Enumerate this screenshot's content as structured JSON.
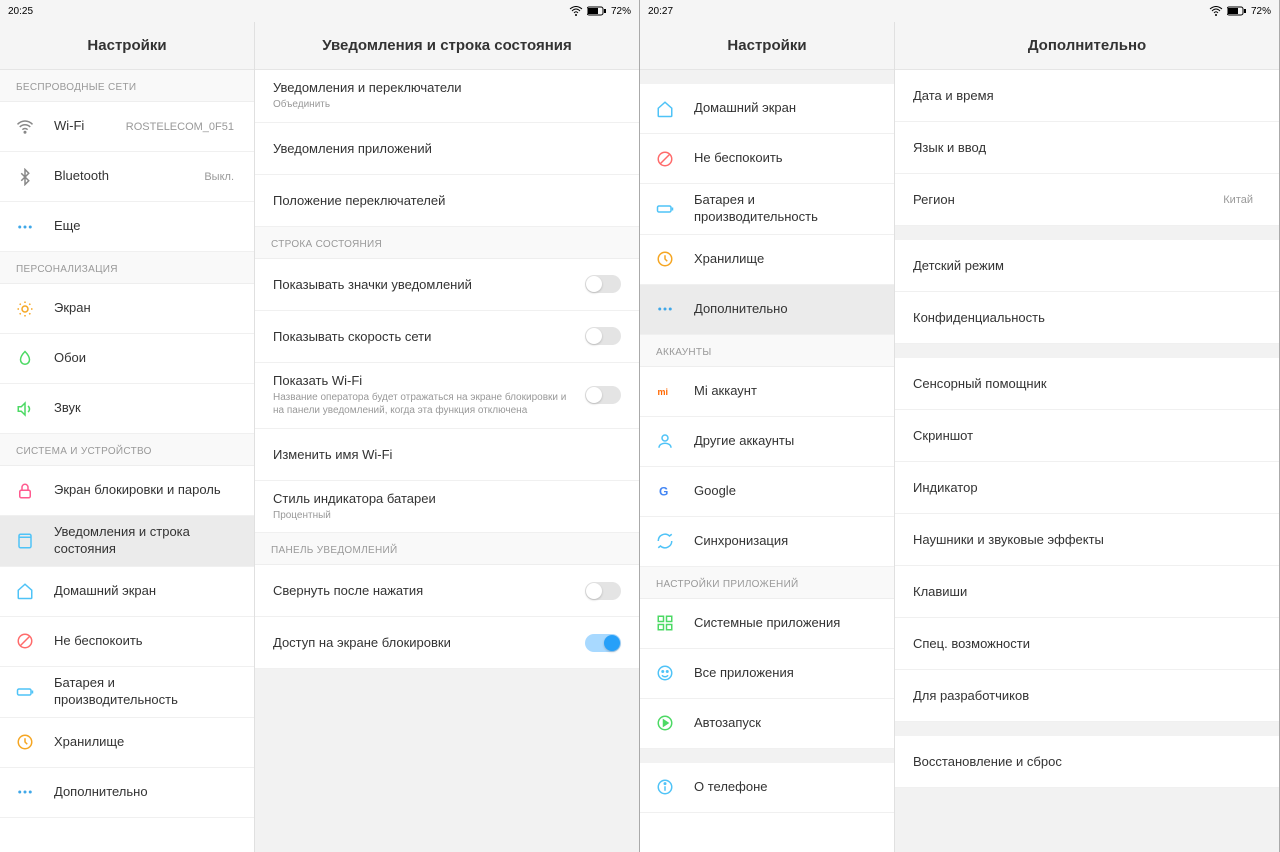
{
  "left_screen": {
    "status": {
      "time": "20:25",
      "battery": "72%"
    },
    "sidebar": {
      "title": "Настройки",
      "sections": [
        {
          "header": "БЕСПРОВОДНЫЕ СЕТИ",
          "items": [
            {
              "label": "Wi-Fi",
              "value": "ROSTELECOM_0F51"
            },
            {
              "label": "Bluetooth",
              "value": "Выкл."
            },
            {
              "label": "Еще"
            }
          ]
        },
        {
          "header": "ПЕРСОНАЛИЗАЦИЯ",
          "items": [
            {
              "label": "Экран"
            },
            {
              "label": "Обои"
            },
            {
              "label": "Звук"
            }
          ]
        },
        {
          "header": "СИСТЕМА И УСТРОЙСТВО",
          "items": [
            {
              "label": "Экран блокировки и пароль"
            },
            {
              "label": "Уведомления и строка состояния",
              "selected": true
            },
            {
              "label": "Домашний экран"
            },
            {
              "label": "Не беспокоить"
            },
            {
              "label": "Батарея и производительность"
            },
            {
              "label": "Хранилище"
            },
            {
              "label": "Дополнительно"
            }
          ]
        }
      ]
    },
    "detail": {
      "title": "Уведомления и строка состояния",
      "groups": [
        {
          "items": [
            {
              "label": "Уведомления и переключатели",
              "sub": "Объединить",
              "chevron": true
            },
            {
              "label": "Уведомления приложений",
              "chevron": true
            },
            {
              "label": "Положение переключателей",
              "chevron": true
            }
          ]
        },
        {
          "header": "СТРОКА СОСТОЯНИЯ",
          "items": [
            {
              "label": "Показывать значки уведомлений",
              "toggle": false
            },
            {
              "label": "Показывать скорость сети",
              "toggle": false
            },
            {
              "label": "Показать Wi-Fi",
              "sub": "Название оператора будет отражаться на экране блокировки и на панели уведомлений, когда эта функция отключена",
              "toggle": false
            },
            {
              "label": "Изменить имя Wi-Fi",
              "chevron": true
            },
            {
              "label": "Стиль индикатора батареи",
              "sub": "Процентный",
              "chevron": true
            }
          ]
        },
        {
          "header": "ПАНЕЛЬ УВЕДОМЛЕНИЙ",
          "items": [
            {
              "label": "Свернуть после нажатия",
              "toggle": false
            },
            {
              "label": "Доступ на экране блокировки",
              "toggle": true
            }
          ]
        }
      ]
    }
  },
  "right_screen": {
    "status": {
      "time": "20:27",
      "battery": "72%"
    },
    "sidebar": {
      "title": "Настройки",
      "sections": [
        {
          "items": [
            {
              "label": "Домашний экран"
            },
            {
              "label": "Не беспокоить"
            },
            {
              "label": "Батарея и производительность"
            },
            {
              "label": "Хранилище"
            },
            {
              "label": "Дополнительно",
              "selected": true
            }
          ]
        },
        {
          "header": "АККАУНТЫ",
          "items": [
            {
              "label": "Mi аккаунт"
            },
            {
              "label": "Другие аккаунты"
            },
            {
              "label": "Google"
            },
            {
              "label": "Синхронизация"
            }
          ]
        },
        {
          "header": "НАСТРОЙКИ ПРИЛОЖЕНИЙ",
          "items": [
            {
              "label": "Системные приложения"
            },
            {
              "label": "Все приложения"
            },
            {
              "label": "Автозапуск"
            }
          ]
        },
        {
          "items": [
            {
              "label": "О телефоне"
            }
          ]
        }
      ]
    },
    "detail": {
      "title": "Дополнительно",
      "groups": [
        {
          "items": [
            {
              "label": "Дата и время",
              "chevron": true
            },
            {
              "label": "Язык и ввод",
              "chevron": true
            },
            {
              "label": "Регион",
              "value": "Китай",
              "chevron": true
            }
          ]
        },
        {
          "items": [
            {
              "label": "Детский режим",
              "chevron": true
            },
            {
              "label": "Конфиденциальность",
              "chevron": true
            }
          ]
        },
        {
          "items": [
            {
              "label": "Сенсорный помощник",
              "chevron": true
            },
            {
              "label": "Скриншот",
              "chevron": true
            },
            {
              "label": "Индикатор",
              "chevron": true
            },
            {
              "label": "Наушники и звуковые эффекты",
              "chevron": true
            },
            {
              "label": "Клавиши",
              "chevron": true
            },
            {
              "label": "Спец. возможности",
              "chevron": true
            },
            {
              "label": "Для разработчиков",
              "chevron": true
            }
          ]
        },
        {
          "items": [
            {
              "label": "Восстановление и сброс",
              "chevron": true
            }
          ]
        }
      ]
    }
  },
  "icons": {
    "wifi": "<svg viewBox='0 0 24 24' fill='none' stroke='#888' stroke-width='2'><path d='M2 8.5C5 5.5 9 4 12 4s7 1.5 10 4.5'/><path d='M5 12c2-2 4.5-3 7-3s5 1 7 3'/><path d='M8.5 15.5c1-1 2.2-1.5 3.5-1.5s2.5.5 3.5 1.5'/><circle cx='12' cy='19' r='1' fill='#888'/></svg>",
    "bluetooth": "<svg viewBox='0 0 24 24' fill='none' stroke='#888' stroke-width='2'><path d='M7 7l10 10-5 5V2l5 5L7 17'/></svg>",
    "more": "<svg viewBox='0 0 24 24' fill='#3fa7e8'><circle cx='5' cy='12' r='2'/><circle cx='12' cy='12' r='2'/><circle cx='19' cy='12' r='2'/></svg>",
    "display": "<svg viewBox='0 0 24 24' fill='none' stroke='#f5a623' stroke-width='2'><circle cx='12' cy='12' r='4'/><path d='M12 2v2M12 20v2M4.9 4.9l1.4 1.4M17.7 17.7l1.4 1.4M2 12h2M20 12h2M4.9 19.1l1.4-1.4M17.7 6.3l1.4-1.4'/></svg>",
    "wallpaper": "<svg viewBox='0 0 24 24' fill='none' stroke='#4cd964' stroke-width='2'><path d='M12 2C8 6 6 9 6 13a6 6 0 0012 0c0-4-2-7-6-11z'/></svg>",
    "sound": "<svg viewBox='0 0 24 24' fill='none' stroke='#4cd964' stroke-width='2'><path d='M3 9v6h4l5 5V4L7 9H3z'/><path d='M16 8a5 5 0 010 8'/></svg>",
    "lock": "<svg viewBox='0 0 24 24' fill='none' stroke='#ff5a8f' stroke-width='2'><rect x='5' y='11' width='14' height='10' rx='2'/><path d='M8 11V7a4 4 0 018 0v4'/></svg>",
    "notif": "<svg viewBox='0 0 24 24' fill='none' stroke='#4fc3f7' stroke-width='2'><rect x='4' y='3' width='16' height='18' rx='2'/><line x1='4' y1='7' x2='20' y2='7'/></svg>",
    "home": "<svg viewBox='0 0 24 24' fill='none' stroke='#4fc3f7' stroke-width='2'><path d='M3 11l9-8 9 8v10a1 1 0 01-1 1H4a1 1 0 01-1-1V11z'/></svg>",
    "dnd": "<svg viewBox='0 0 24 24' fill='none' stroke='#ff6b6b' stroke-width='2'><circle cx='12' cy='12' r='9'/><line x1='6' y1='18' x2='18' y2='6'/></svg>",
    "battery": "<svg viewBox='0 0 24 24' fill='none' stroke='#4fc3f7' stroke-width='2'><rect x='2' y='8' width='18' height='8' rx='2'/><line x1='22' y1='10' x2='22' y2='14'/></svg>",
    "storage": "<svg viewBox='0 0 24 24' fill='none' stroke='#f5a623' stroke-width='2'><circle cx='12' cy='12' r='9'/><path d='M12 7v5l3 3'/></svg>",
    "additional": "<svg viewBox='0 0 24 24' fill='#3fa7e8'><circle cx='5' cy='12' r='2'/><circle cx='12' cy='12' r='2'/><circle cx='19' cy='12' r='2'/></svg>",
    "mi": "<svg viewBox='0 0 24 24'><text x='2' y='17' font-size='12' fill='#ff6700' font-weight='bold'>mi</text></svg>",
    "accounts": "<svg viewBox='0 0 24 24' fill='none' stroke='#4fc3f7' stroke-width='2'><circle cx='12' cy='8' r='4'/><path d='M4 21c0-4 4-6 8-6s8 2 8 6'/></svg>",
    "google": "<svg viewBox='0 0 24 24'><text x='4' y='18' font-size='16' fill='#4285f4' font-weight='bold'>G</text></svg>",
    "sync": "<svg viewBox='0 0 24 24' fill='none' stroke='#4fc3f7' stroke-width='2'><path d='M21 12a9 9 0 01-15 6.7L3 21M3 12a9 9 0 0115-6.7L21 3'/></svg>",
    "sysapps": "<svg viewBox='0 0 24 24' fill='none' stroke='#4cd964' stroke-width='2'><rect x='3' y='3' width='7' height='7'/><rect x='14' y='3' width='7' height='7'/><rect x='3' y='14' width='7' height='7'/><rect x='14' y='14' width='7' height='7'/></svg>",
    "allapps": "<svg viewBox='0 0 24 24' fill='none' stroke='#4fc3f7' stroke-width='2'><circle cx='12' cy='12' r='9'/><circle cx='9' cy='10' r='1' fill='#4fc3f7'/><circle cx='15' cy='10' r='1' fill='#4fc3f7'/><path d='M8 15c1 1.5 2.5 2 4 2s3-.5 4-2'/></svg>",
    "autostart": "<svg viewBox='0 0 24 24' fill='none' stroke='#4cd964' stroke-width='2'><circle cx='12' cy='12' r='9'/><path d='M10 8l6 4-6 4V8z' fill='#4cd964'/></svg>",
    "about": "<svg viewBox='0 0 24 24' fill='none' stroke='#4fc3f7' stroke-width='2'><circle cx='12' cy='12' r='9'/><line x1='12' y1='11' x2='12' y2='17'/><circle cx='12' cy='7.5' r='1' fill='#4fc3f7'/></svg>"
  }
}
